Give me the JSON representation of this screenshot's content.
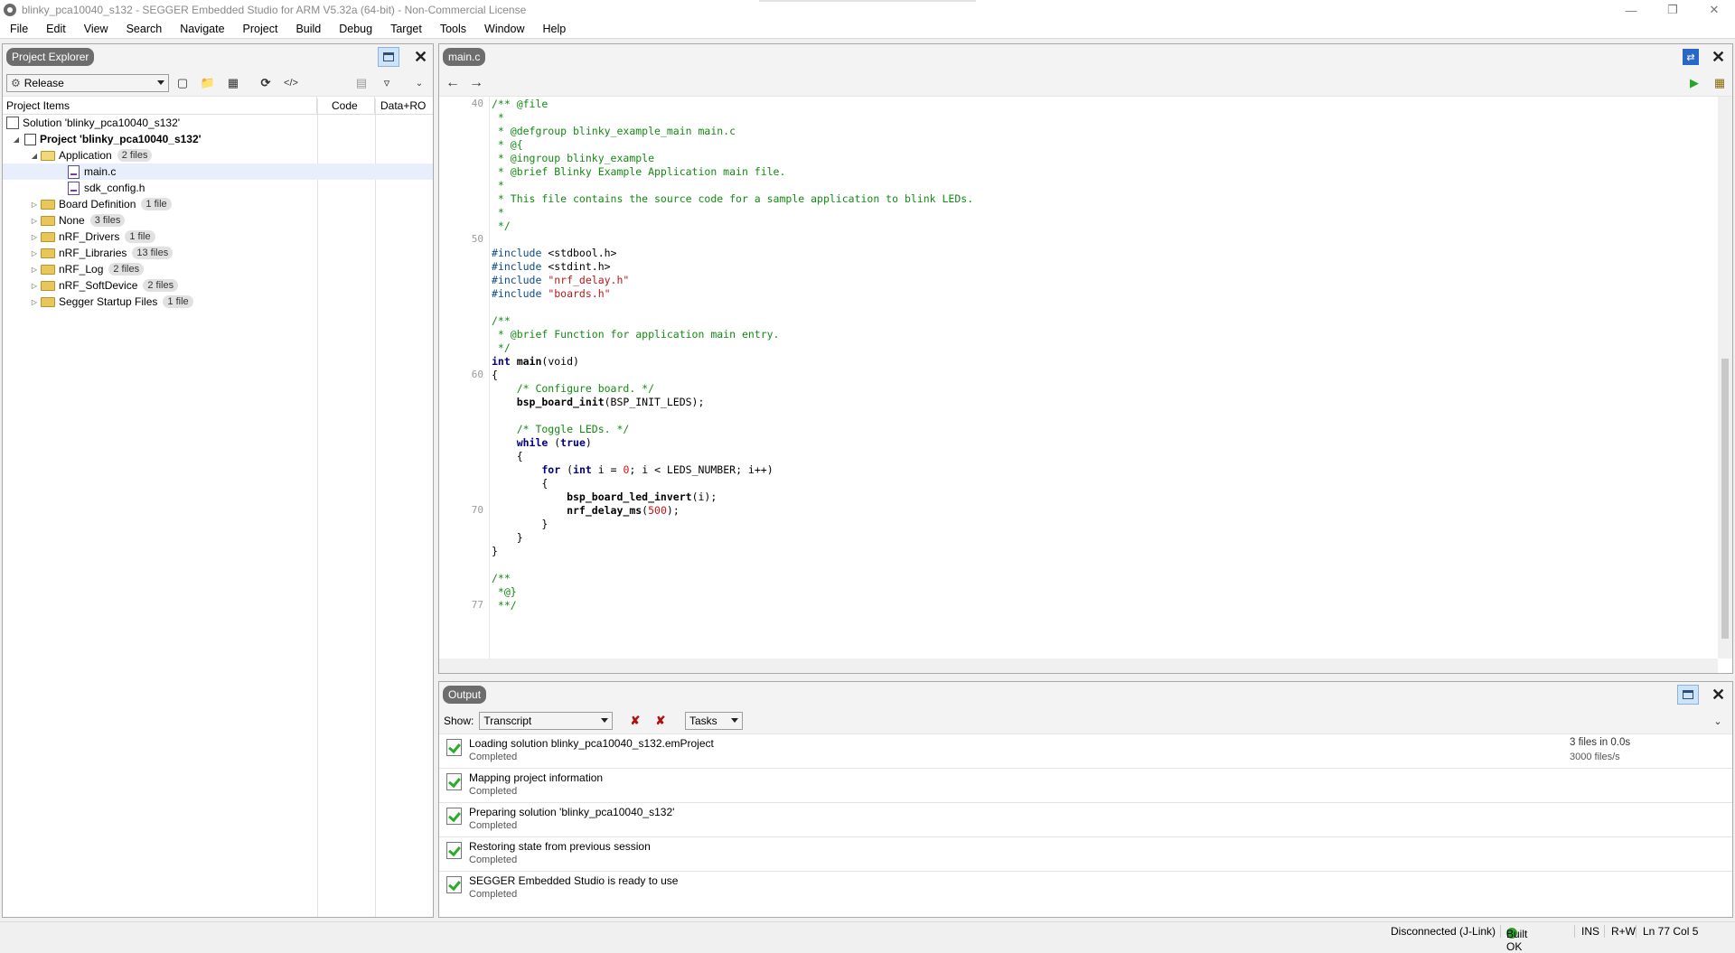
{
  "window": {
    "title": "blinky_pca10040_s132 - SEGGER Embedded Studio for ARM V5.32a (64-bit) - Non-Commercial License"
  },
  "menu": [
    "File",
    "Edit",
    "View",
    "Search",
    "Navigate",
    "Project",
    "Build",
    "Debug",
    "Target",
    "Tools",
    "Window",
    "Help"
  ],
  "project_explorer": {
    "tab_label": "Project Explorer",
    "config": "Release",
    "columns": {
      "items": "Project Items",
      "code": "Code",
      "data": "Data+RO"
    },
    "solution": "Solution 'blinky_pca10040_s132'",
    "project": "Project 'blinky_pca10040_s132'",
    "application": {
      "label": "Application",
      "badge": "2 files"
    },
    "files": [
      "main.c",
      "sdk_config.h"
    ],
    "folders": [
      {
        "label": "Board Definition",
        "badge": "1 file"
      },
      {
        "label": "None",
        "badge": "3 files"
      },
      {
        "label": "nRF_Drivers",
        "badge": "1 file"
      },
      {
        "label": "nRF_Libraries",
        "badge": "13 files"
      },
      {
        "label": "nRF_Log",
        "badge": "2 files"
      },
      {
        "label": "nRF_SoftDevice",
        "badge": "2 files"
      },
      {
        "label": "Segger Startup Files",
        "badge": "1 file"
      }
    ]
  },
  "editor": {
    "tab_label": "main.c",
    "line_numbers": [
      "40",
      "50",
      "60",
      "70",
      "77"
    ],
    "code": {
      "l40": "/** @file",
      "l41": " *",
      "l42": " * @defgroup blinky_example_main main.c",
      "l43": " * @{",
      "l44": " * @ingroup blinky_example",
      "l45": " * @brief Blinky Example Application main file.",
      "l46": " *",
      "l47": " * This file contains the source code for a sample application to blink LEDs.",
      "l48": " *",
      "l49": " */",
      "inc1_kw": "#include",
      "inc1_v": " <stdbool.h>",
      "inc2_kw": "#include",
      "inc2_v": " <stdint.h>",
      "inc3_kw": "#include",
      "inc3_v": " \"nrf_delay.h\"",
      "inc4_kw": "#include",
      "inc4_v": " \"boards.h\"",
      "c55": "/**",
      "c56": " * @brief Function for application main entry.",
      "c57": " */",
      "main_kw": "int",
      "main_fn": " main",
      "main_rest": "(void)",
      "brace_open": "{",
      "cfg_comment": "    /* Configure board. */",
      "init_fn": "    bsp_board_init",
      "init_rest": "(BSP_INIT_LEDS);",
      "toggle_comment": "    /* Toggle LEDs. */",
      "while_kw": "    while",
      "while_rest": " (",
      "while_true": "true",
      "while_close": ")",
      "brace2": "    {",
      "for_kw": "        for",
      "for_a": " (",
      "for_int": "int",
      "for_b": " i = ",
      "for_zero": "0",
      "for_c": "; i < LEDS_NUMBER; i++)",
      "brace3": "        {",
      "inv_fn": "            bsp_board_led_invert",
      "inv_rest": "(i);",
      "delay_fn": "            nrf_delay_ms",
      "delay_a": "(",
      "delay_num": "500",
      "delay_b": ");",
      "brace3c": "        }",
      "brace2c": "    }",
      "brace_close": "}",
      "e75": "/**",
      "e76": " *@}",
      "e77": " **/"
    }
  },
  "output": {
    "tab_label": "Output",
    "show_label": "Show:",
    "show_value": "Transcript",
    "tasks_value": "Tasks",
    "rows": [
      {
        "title": "Loading solution blinky_pca10040_s132.emProject",
        "status": "Completed",
        "right1": "3 files in 0.0s",
        "right2": "3000 files/s"
      },
      {
        "title": "Mapping project information",
        "status": "Completed"
      },
      {
        "title": "Preparing solution 'blinky_pca10040_s132'",
        "status": "Completed"
      },
      {
        "title": "Restoring state from previous session",
        "status": "Completed"
      },
      {
        "title": "SEGGER Embedded Studio is ready to use",
        "status": "Completed"
      }
    ]
  },
  "statusbar": {
    "connection": "Disconnected (J-Link)",
    "build": "Built OK",
    "mode": "INS",
    "rw": "R+W",
    "position": "Ln 77 Col 5"
  }
}
